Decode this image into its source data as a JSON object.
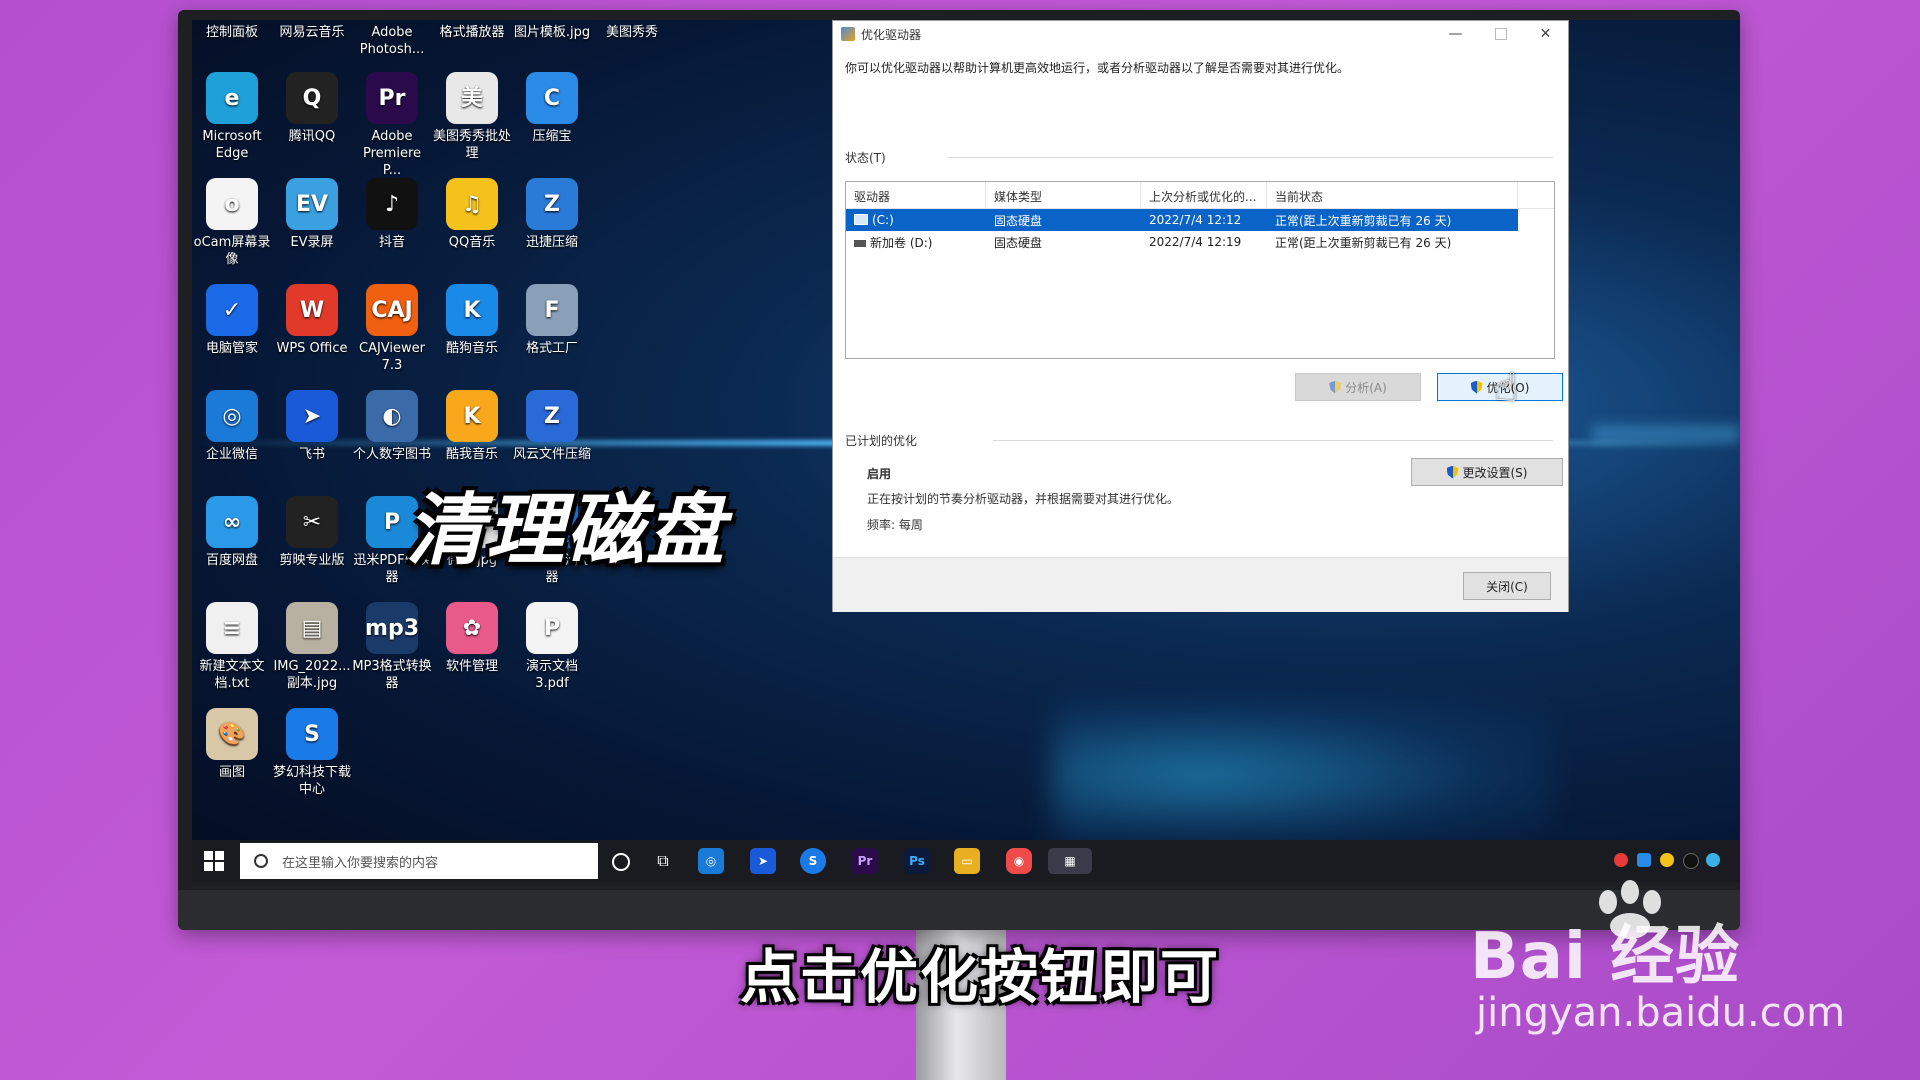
{
  "desktop": {
    "top_row": [
      "控制面板",
      "网易云音乐",
      "Adobe Photosh...",
      "格式播放器",
      "图片模板.jpg",
      "美图秀秀"
    ],
    "icons": [
      {
        "label": "Microsoft Edge",
        "glyph": "e",
        "color": "#1fa0d8"
      },
      {
        "label": "腾讯QQ",
        "glyph": "Q",
        "color": "#222"
      },
      {
        "label": "Adobe Premiere P...",
        "glyph": "Pr",
        "color": "#2a0a4a"
      },
      {
        "label": "美图秀秀批处理",
        "glyph": "美",
        "color": "#e8e8e8"
      },
      {
        "label": "压缩宝",
        "glyph": "C",
        "color": "#2a8ae8"
      },
      {
        "label": "oCam屏幕录像",
        "glyph": "o",
        "color": "#f4f4f4"
      },
      {
        "label": "EV录屏",
        "glyph": "EV",
        "color": "#3aa0e0"
      },
      {
        "label": "抖音",
        "glyph": "♪",
        "color": "#111"
      },
      {
        "label": "QQ音乐",
        "glyph": "♫",
        "color": "#f4c21a"
      },
      {
        "label": "迅捷压缩",
        "glyph": "Z",
        "color": "#2a7ad8"
      },
      {
        "label": "电脑管家",
        "glyph": "✓",
        "color": "#1a6ae8"
      },
      {
        "label": "WPS Office",
        "glyph": "W",
        "color": "#e23a2a"
      },
      {
        "label": "CAJViewer 7.3",
        "glyph": "CAJ",
        "color": "#f06010"
      },
      {
        "label": "酷狗音乐",
        "glyph": "K",
        "color": "#1a8ae8"
      },
      {
        "label": "格式工厂",
        "glyph": "F",
        "color": "#8aa0b8"
      },
      {
        "label": "企业微信",
        "glyph": "◎",
        "color": "#1a7ad8"
      },
      {
        "label": "飞书",
        "glyph": "➤",
        "color": "#1a5ad8"
      },
      {
        "label": "个人数字图书",
        "glyph": "◐",
        "color": "#3a6aa8"
      },
      {
        "label": "酷我音乐",
        "glyph": "K",
        "color": "#f8a81a"
      },
      {
        "label": "风云文件压缩",
        "glyph": "Z",
        "color": "#2a6ad8"
      },
      {
        "label": "百度网盘",
        "glyph": "∞",
        "color": "#2a9ae8"
      },
      {
        "label": "剪映专业版",
        "glyph": "✂",
        "color": "#222"
      },
      {
        "label": "迅米PDF转换器",
        "glyph": "P",
        "color": "#1a8ad8"
      },
      {
        "label": "微信.jpg",
        "glyph": "▦",
        "color": "#ddd"
      },
      {
        "label": "搜狗高速浏览器",
        "glyph": "S",
        "color": "#1a7ae8"
      },
      {
        "label": "新建文本文档.txt",
        "glyph": "≡",
        "color": "#f0f0f0"
      },
      {
        "label": "IMG_2022...副本.jpg",
        "glyph": "▤",
        "color": "#b8b0a0"
      },
      {
        "label": "MP3格式转换器",
        "glyph": "mp3",
        "color": "#1a3a6a"
      },
      {
        "label": "软件管理",
        "glyph": "✿",
        "color": "#e85a8a"
      },
      {
        "label": "演示文档3.pdf",
        "glyph": "P",
        "color": "#f4f4f4"
      },
      {
        "label": "画图",
        "glyph": "🎨",
        "color": "#d8c8a8"
      },
      {
        "label": "梦幻科技下载中心",
        "glyph": "S",
        "color": "#1a7ae8"
      }
    ]
  },
  "overlay_title": "清理磁盘",
  "dialog": {
    "title": "优化驱动器",
    "description": "你可以优化驱动器以帮助计算机更高效地运行，或者分析驱动器以了解是否需要对其进行优化。",
    "status_label": "状态(T)",
    "columns": [
      "驱动器",
      "媒体类型",
      "上次分析或优化的...",
      "当前状态"
    ],
    "rows": [
      {
        "drive": "(C:)",
        "media": "固态硬盘",
        "last": "2022/7/4 12:12",
        "status": "正常(距上次重新剪裁已有 26 天)",
        "selected": true
      },
      {
        "drive": "新加卷 (D:)",
        "media": "固态硬盘",
        "last": "2022/7/4 12:19",
        "status": "正常(距上次重新剪裁已有 26 天)",
        "selected": false
      }
    ],
    "analyze_button": "分析(A)",
    "optimize_button": "优化(O)",
    "scheduled_label": "已计划的优化",
    "enabled_label": "启用",
    "scheduled_desc": "正在按计划的节奏分析驱动器，并根据需要对其进行优化。",
    "frequency": "频率: 每周",
    "change_settings_button": "更改设置(S)",
    "close_button": "关闭(C)"
  },
  "taskbar": {
    "search_placeholder": "在这里输入你要搜索的内容"
  },
  "subtitle": "点击优化按钮即可",
  "watermark": {
    "brand": "Bai 经验",
    "url": "jingyan.baidu.com"
  }
}
